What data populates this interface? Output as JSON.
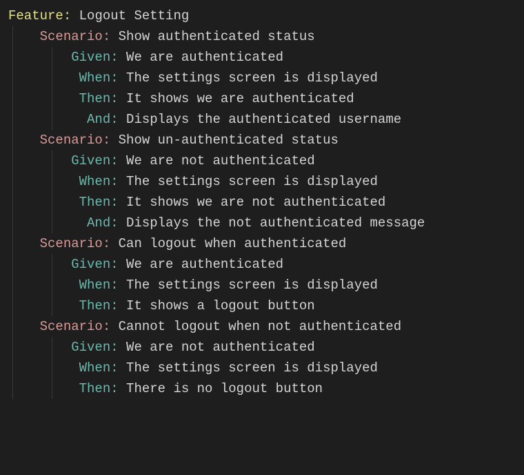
{
  "keywords": {
    "feature": "Feature",
    "scenario": "Scenario",
    "given": "Given",
    "when": "When",
    "then": "Then",
    "and": "And"
  },
  "feature": {
    "title": "Logout Setting",
    "scenarios": [
      {
        "title": "Show authenticated status",
        "steps": [
          {
            "keyword": "given",
            "text": "We are authenticated"
          },
          {
            "keyword": "when",
            "text": "The settings screen is displayed"
          },
          {
            "keyword": "then",
            "text": "It shows we are authenticated"
          },
          {
            "keyword": "and",
            "text": "Displays the authenticated username"
          }
        ]
      },
      {
        "title": "Show un-authenticated status",
        "steps": [
          {
            "keyword": "given",
            "text": "We are not authenticated"
          },
          {
            "keyword": "when",
            "text": "The settings screen is displayed"
          },
          {
            "keyword": "then",
            "text": "It shows we are not authenticated"
          },
          {
            "keyword": "and",
            "text": "Displays the not authenticated message"
          }
        ]
      },
      {
        "title": "Can logout when authenticated",
        "steps": [
          {
            "keyword": "given",
            "text": "We are authenticated"
          },
          {
            "keyword": "when",
            "text": "The settings screen is displayed"
          },
          {
            "keyword": "then",
            "text": "It shows a logout button"
          }
        ]
      },
      {
        "title": "Cannot logout when not authenticated",
        "steps": [
          {
            "keyword": "given",
            "text": "We are not authenticated"
          },
          {
            "keyword": "when",
            "text": "The settings screen is displayed"
          },
          {
            "keyword": "then",
            "text": "There is no logout button"
          }
        ]
      }
    ]
  },
  "indent": {
    "scenario_spaces": 4,
    "step_pad_width": 13
  }
}
